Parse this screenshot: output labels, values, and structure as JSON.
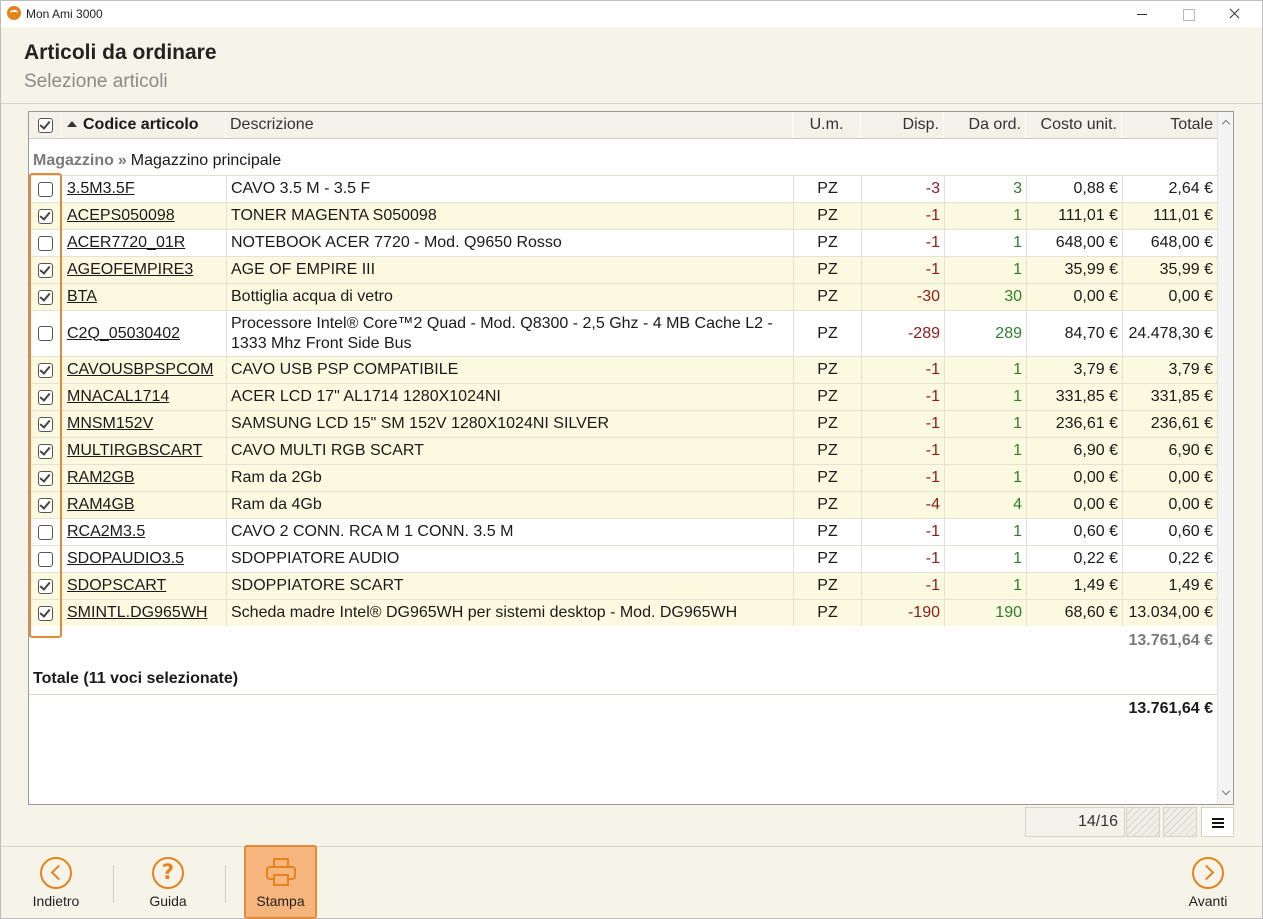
{
  "window": {
    "app_title": "Mon Ami 3000"
  },
  "header": {
    "title": "Articoli da ordinare",
    "subtitle": "Selezione articoli"
  },
  "table": {
    "columns": {
      "code": "Codice articolo",
      "description": "Descrizione",
      "um": "U.m.",
      "disp": "Disp.",
      "da_ord": "Da ord.",
      "costo": "Costo unit.",
      "totale": "Totale"
    },
    "sort": {
      "column": "Codice articolo",
      "direction": "ascending"
    },
    "group": {
      "label": "Magazzino",
      "separator": "»",
      "value": "Magazzino principale"
    },
    "rows": [
      {
        "checked": false,
        "code": "3.5M3.5F",
        "desc": "CAVO 3.5 M - 3.5 F",
        "um": "PZ",
        "disp": "-3",
        "da_ord": "3",
        "costo": "0,88 €",
        "totale": "2,64 €"
      },
      {
        "checked": true,
        "code": "ACEPS050098",
        "desc": "TONER MAGENTA S050098",
        "um": "PZ",
        "disp": "-1",
        "da_ord": "1",
        "costo": "111,01 €",
        "totale": "111,01 €"
      },
      {
        "checked": false,
        "code": "ACER7720_01R",
        "desc": "NOTEBOOK ACER 7720 - Mod. Q9650 Rosso",
        "um": "PZ",
        "disp": "-1",
        "da_ord": "1",
        "costo": "648,00 €",
        "totale": "648,00 €"
      },
      {
        "checked": true,
        "code": "AGEOFEMPIRE3",
        "desc": "AGE OF EMPIRE III",
        "um": "PZ",
        "disp": "-1",
        "da_ord": "1",
        "costo": "35,99 €",
        "totale": "35,99 €"
      },
      {
        "checked": true,
        "code": "BTA",
        "desc": "Bottiglia acqua di vetro",
        "um": "PZ",
        "disp": "-30",
        "da_ord": "30",
        "costo": "0,00 €",
        "totale": "0,00 €"
      },
      {
        "checked": false,
        "code": "C2Q_05030402",
        "desc": "Processore Intel® Core™2 Quad - Mod. Q8300 - 2,5 Ghz - 4 MB Cache L2 - 1333 Mhz Front Side Bus",
        "um": "PZ",
        "disp": "-289",
        "da_ord": "289",
        "costo": "84,70 €",
        "totale": "24.478,30 €"
      },
      {
        "checked": true,
        "code": "CAVOUSBPSPCOM",
        "desc": "CAVO USB PSP COMPATIBILE",
        "um": "PZ",
        "disp": "-1",
        "da_ord": "1",
        "costo": "3,79 €",
        "totale": "3,79 €"
      },
      {
        "checked": true,
        "code": "MNACAL1714",
        "desc": "ACER LCD 17\" AL1714 1280X1024NI",
        "um": "PZ",
        "disp": "-1",
        "da_ord": "1",
        "costo": "331,85 €",
        "totale": "331,85 €"
      },
      {
        "checked": true,
        "code": "MNSM152V",
        "desc": "SAMSUNG LCD 15\" SM 152V 1280X1024NI SILVER",
        "um": "PZ",
        "disp": "-1",
        "da_ord": "1",
        "costo": "236,61 €",
        "totale": "236,61 €"
      },
      {
        "checked": true,
        "code": "MULTIRGBSCART",
        "desc": "CAVO MULTI RGB SCART",
        "um": "PZ",
        "disp": "-1",
        "da_ord": "1",
        "costo": "6,90 €",
        "totale": "6,90 €"
      },
      {
        "checked": true,
        "code": "RAM2GB",
        "desc": "Ram da 2Gb",
        "um": "PZ",
        "disp": "-1",
        "da_ord": "1",
        "costo": "0,00 €",
        "totale": "0,00 €"
      },
      {
        "checked": true,
        "code": "RAM4GB",
        "desc": "Ram da 4Gb",
        "um": "PZ",
        "disp": "-4",
        "da_ord": "4",
        "costo": "0,00 €",
        "totale": "0,00 €"
      },
      {
        "checked": false,
        "code": "RCA2M3.5",
        "desc": "CAVO 2 CONN. RCA M 1 CONN. 3.5 M",
        "um": "PZ",
        "disp": "-1",
        "da_ord": "1",
        "costo": "0,60 €",
        "totale": "0,60 €"
      },
      {
        "checked": false,
        "code": "SDOPAUDIO3.5",
        "desc": "SDOPPIATORE AUDIO",
        "um": "PZ",
        "disp": "-1",
        "da_ord": "1",
        "costo": "0,22 €",
        "totale": "0,22 €"
      },
      {
        "checked": true,
        "code": "SDOPSCART",
        "desc": "SDOPPIATORE SCART",
        "um": "PZ",
        "disp": "-1",
        "da_ord": "1",
        "costo": "1,49 €",
        "totale": "1,49 €"
      },
      {
        "checked": true,
        "code": "SMINTL.DG965WH",
        "desc": "Scheda madre Intel® DG965WH per sistemi desktop - Mod. DG965WH",
        "um": "PZ",
        "disp": "-190",
        "da_ord": "190",
        "costo": "68,60 €",
        "totale": "13.034,00 €"
      }
    ],
    "group_subtotal": "13.761,64 €",
    "total_label": "Totale (11 voci selezionate)",
    "total_value": "13.761,64 €"
  },
  "pager": {
    "position": "14/16"
  },
  "footer": {
    "back_label": "Indietro",
    "help_label": "Guida",
    "print_label": "Stampa",
    "next_label": "Avanti"
  },
  "colors": {
    "accent": "#e2841b",
    "selected_row": "#fbfae0",
    "negative": "#8b1a1a",
    "positive": "#2e7d2e"
  }
}
